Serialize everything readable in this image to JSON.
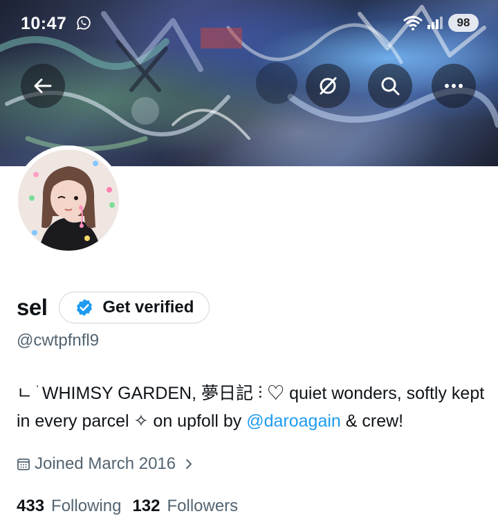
{
  "status_bar": {
    "time": "10:47",
    "battery": "98"
  },
  "profile": {
    "display_name": "sel",
    "verify_label": "Get verified",
    "handle": "@cwtpfnfl9",
    "bio_prefix": "ㄴ ֺ WHIMSY GARDEN, 夢日記 ⫶ ♡ quiet wonders, softly kept in every parcel ✧ on upfoll by ",
    "bio_mention": "@daroagain",
    "bio_suffix": " & crew!",
    "joined": "Joined March 2016",
    "following_count": "433",
    "following_label": "Following",
    "followers_count": "132",
    "followers_label": "Followers"
  },
  "colors": {
    "accent": "#1d9bf0",
    "secondary_text": "#536471",
    "primary_text": "#0f1419"
  },
  "icons": {
    "back": "arrow-left-icon",
    "grok": "slashed-circle-icon",
    "search": "search-icon",
    "more": "more-icon",
    "verified": "verified-badge-icon",
    "calendar": "calendar-icon",
    "chevron": "chevron-right-icon"
  }
}
